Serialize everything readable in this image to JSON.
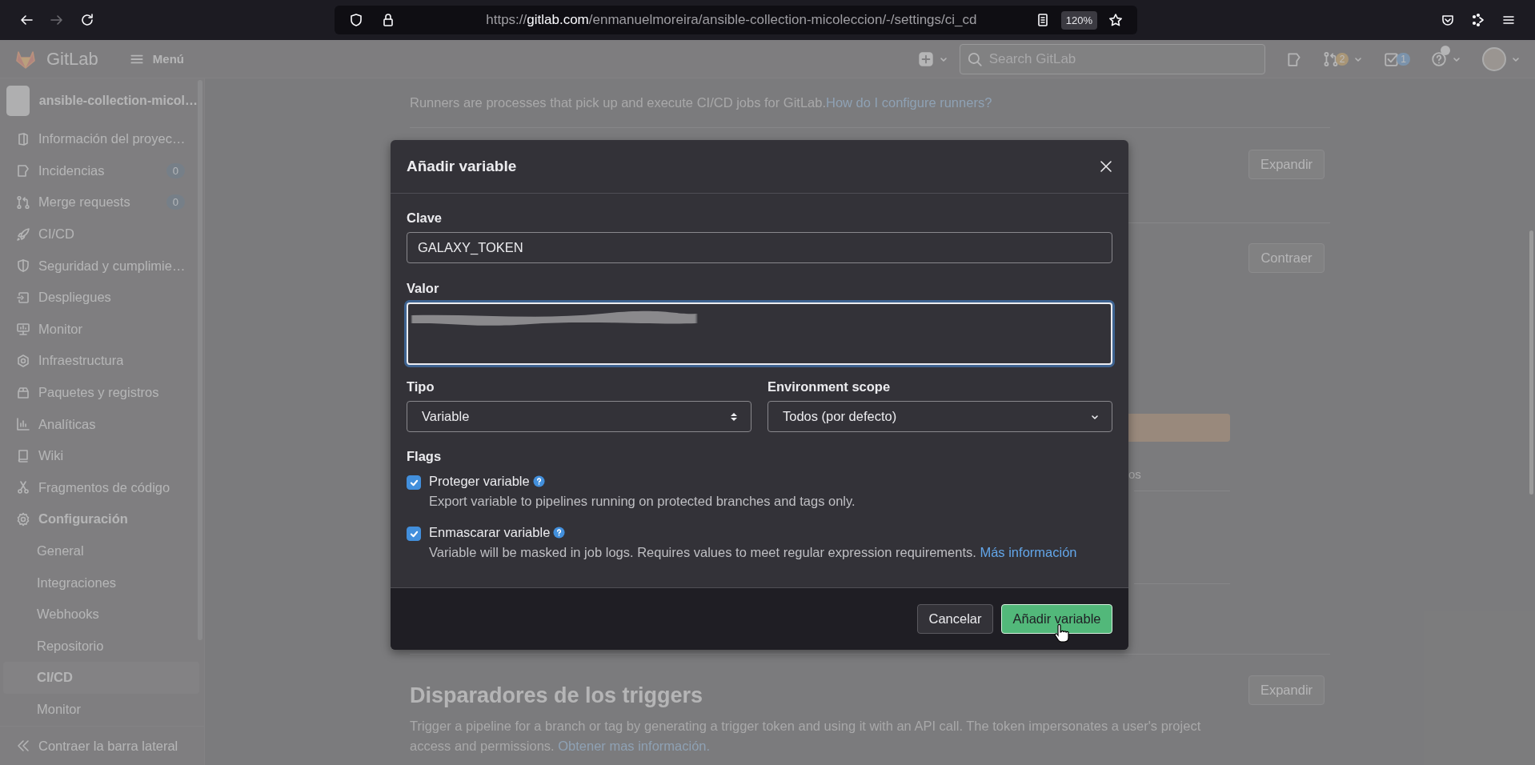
{
  "browser": {
    "url_scheme": "https://",
    "url_host": "gitlab.com",
    "url_path": "/enmanuelmoreira/ansible-collection-micoleccion/-/settings/ci_cd",
    "zoom": "120%",
    "forward_disabled": true
  },
  "header": {
    "logo": "GitLab",
    "menu": "Menú",
    "search_placeholder": "Search GitLab",
    "merge_requests_count": "2",
    "todos_count": "1"
  },
  "sidebar": {
    "project": "ansible-collection-micol…",
    "items": [
      {
        "label": "Información del proyec…",
        "selected": false
      },
      {
        "label": "Incidencias",
        "badge": "0",
        "selected": false
      },
      {
        "label": "Merge requests",
        "badge": "0",
        "selected": false
      },
      {
        "label": "CI/CD",
        "selected": false
      },
      {
        "label": "Seguridad y cumplimie…",
        "selected": false
      },
      {
        "label": "Despliegues",
        "selected": false
      },
      {
        "label": "Monitor",
        "selected": false
      },
      {
        "label": "Infraestructura",
        "selected": false
      },
      {
        "label": "Paquetes y registros",
        "selected": false
      },
      {
        "label": "Analíticas",
        "selected": false
      },
      {
        "label": "Wiki",
        "selected": false
      },
      {
        "label": "Fragmentos de código",
        "selected": false
      },
      {
        "label": "Configuración",
        "selected": false,
        "children": [
          {
            "label": "General",
            "selected": false
          },
          {
            "label": "Integraciones",
            "selected": false
          },
          {
            "label": "Webhooks",
            "selected": false
          },
          {
            "label": "Repositorio",
            "selected": false
          },
          {
            "label": "CI/CD",
            "selected": true
          },
          {
            "label": "Monitor",
            "selected": false
          }
        ]
      }
    ],
    "collapse": "Contraer la barra lateral"
  },
  "main": {
    "intro": {
      "text": "Runners are processes that pick up and execute CI/CD jobs for GitLab.",
      "link": "How do I configure runners?"
    },
    "section_buttons": [
      "Expandir",
      "Contraer"
    ],
    "partial_text": "os",
    "triggers": {
      "title": "Disparadores de los triggers",
      "button": "Expandir",
      "text": "Trigger a pipeline for a branch or tag by generating a trigger token and using it with an API call. The token impersonates a user's project access and permissions.",
      "link": "Obtener mas información."
    }
  },
  "modal": {
    "title": "Añadir variable",
    "key": {
      "label": "Clave",
      "value": "GALAXY_TOKEN"
    },
    "value": {
      "label": "Valor",
      "focused": true
    },
    "type": {
      "label": "Tipo",
      "value": "Variable"
    },
    "scope": {
      "label": "Environment scope",
      "value": "Todos (por defecto)"
    },
    "flags_label": "Flags",
    "flags": [
      {
        "label": "Proteger variable",
        "help": "Export variable to pipelines running on protected branches and tags only.",
        "checked": true
      },
      {
        "label": "Enmascarar variable",
        "help": "Variable will be masked in job logs. Requires values to meet regular expression requirements.",
        "link": "Más información",
        "checked": true
      }
    ],
    "cancel": "Cancelar",
    "submit": "Añadir variable"
  }
}
